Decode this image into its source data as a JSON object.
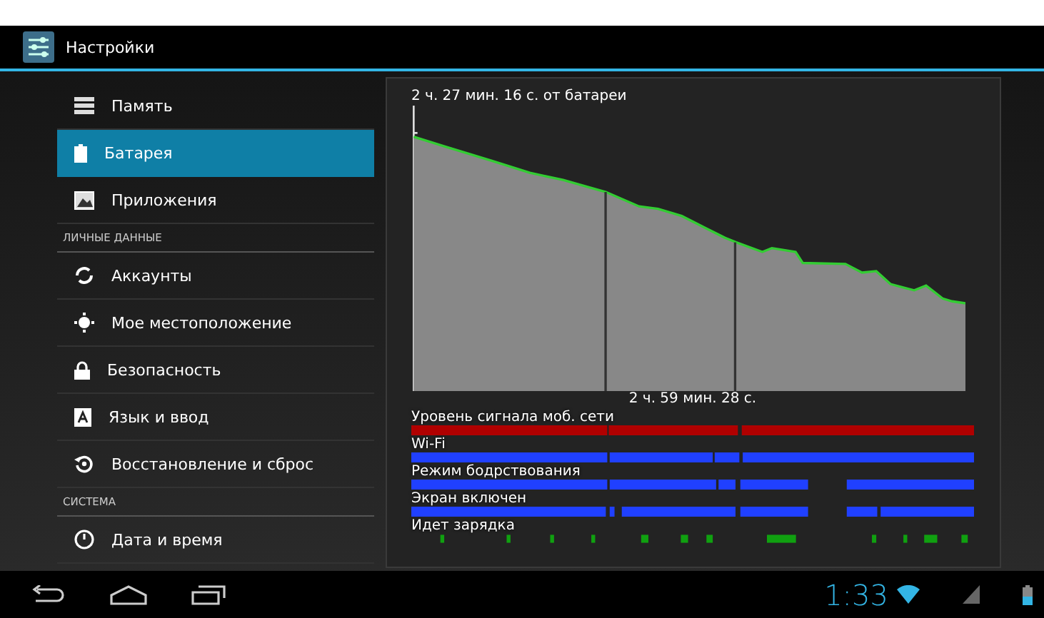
{
  "action_bar": {
    "title": "Настройки"
  },
  "sidebar": {
    "items": [
      {
        "kind": "item",
        "label": "Память",
        "selected": false
      },
      {
        "kind": "item",
        "label": "Батарея",
        "selected": true
      },
      {
        "kind": "item",
        "label": "Приложения",
        "selected": false
      },
      {
        "kind": "header",
        "label": "ЛИЧНЫЕ ДАННЫЕ"
      },
      {
        "kind": "item",
        "label": "Аккаунты",
        "selected": false
      },
      {
        "kind": "item",
        "label": "Мое местоположение",
        "selected": false
      },
      {
        "kind": "item",
        "label": "Безопасность",
        "selected": false
      },
      {
        "kind": "item",
        "label": "Язык и ввод",
        "selected": false
      },
      {
        "kind": "item",
        "label": "Восстановление и сброс",
        "selected": false
      },
      {
        "kind": "header",
        "label": "СИСТЕМА"
      },
      {
        "kind": "item",
        "label": "Дата и время",
        "selected": false
      }
    ]
  },
  "battery": {
    "title": "2 ч. 27 мин. 16 с. от батареи",
    "elapsed": "2 ч. 59 мин. 28 с.",
    "timelines": [
      {
        "label": "Уровень сигнала моб. сети",
        "color": "#b00000"
      },
      {
        "label": "Wi-Fi",
        "color": "#2040ff"
      },
      {
        "label": "Режим бодрствования",
        "color": "#2040ff"
      },
      {
        "label": "Экран включен",
        "color": "#2040ff"
      },
      {
        "label": "Идет зарядка",
        "color": "#10a010"
      }
    ]
  },
  "status_bar": {
    "time": "1:33"
  }
}
